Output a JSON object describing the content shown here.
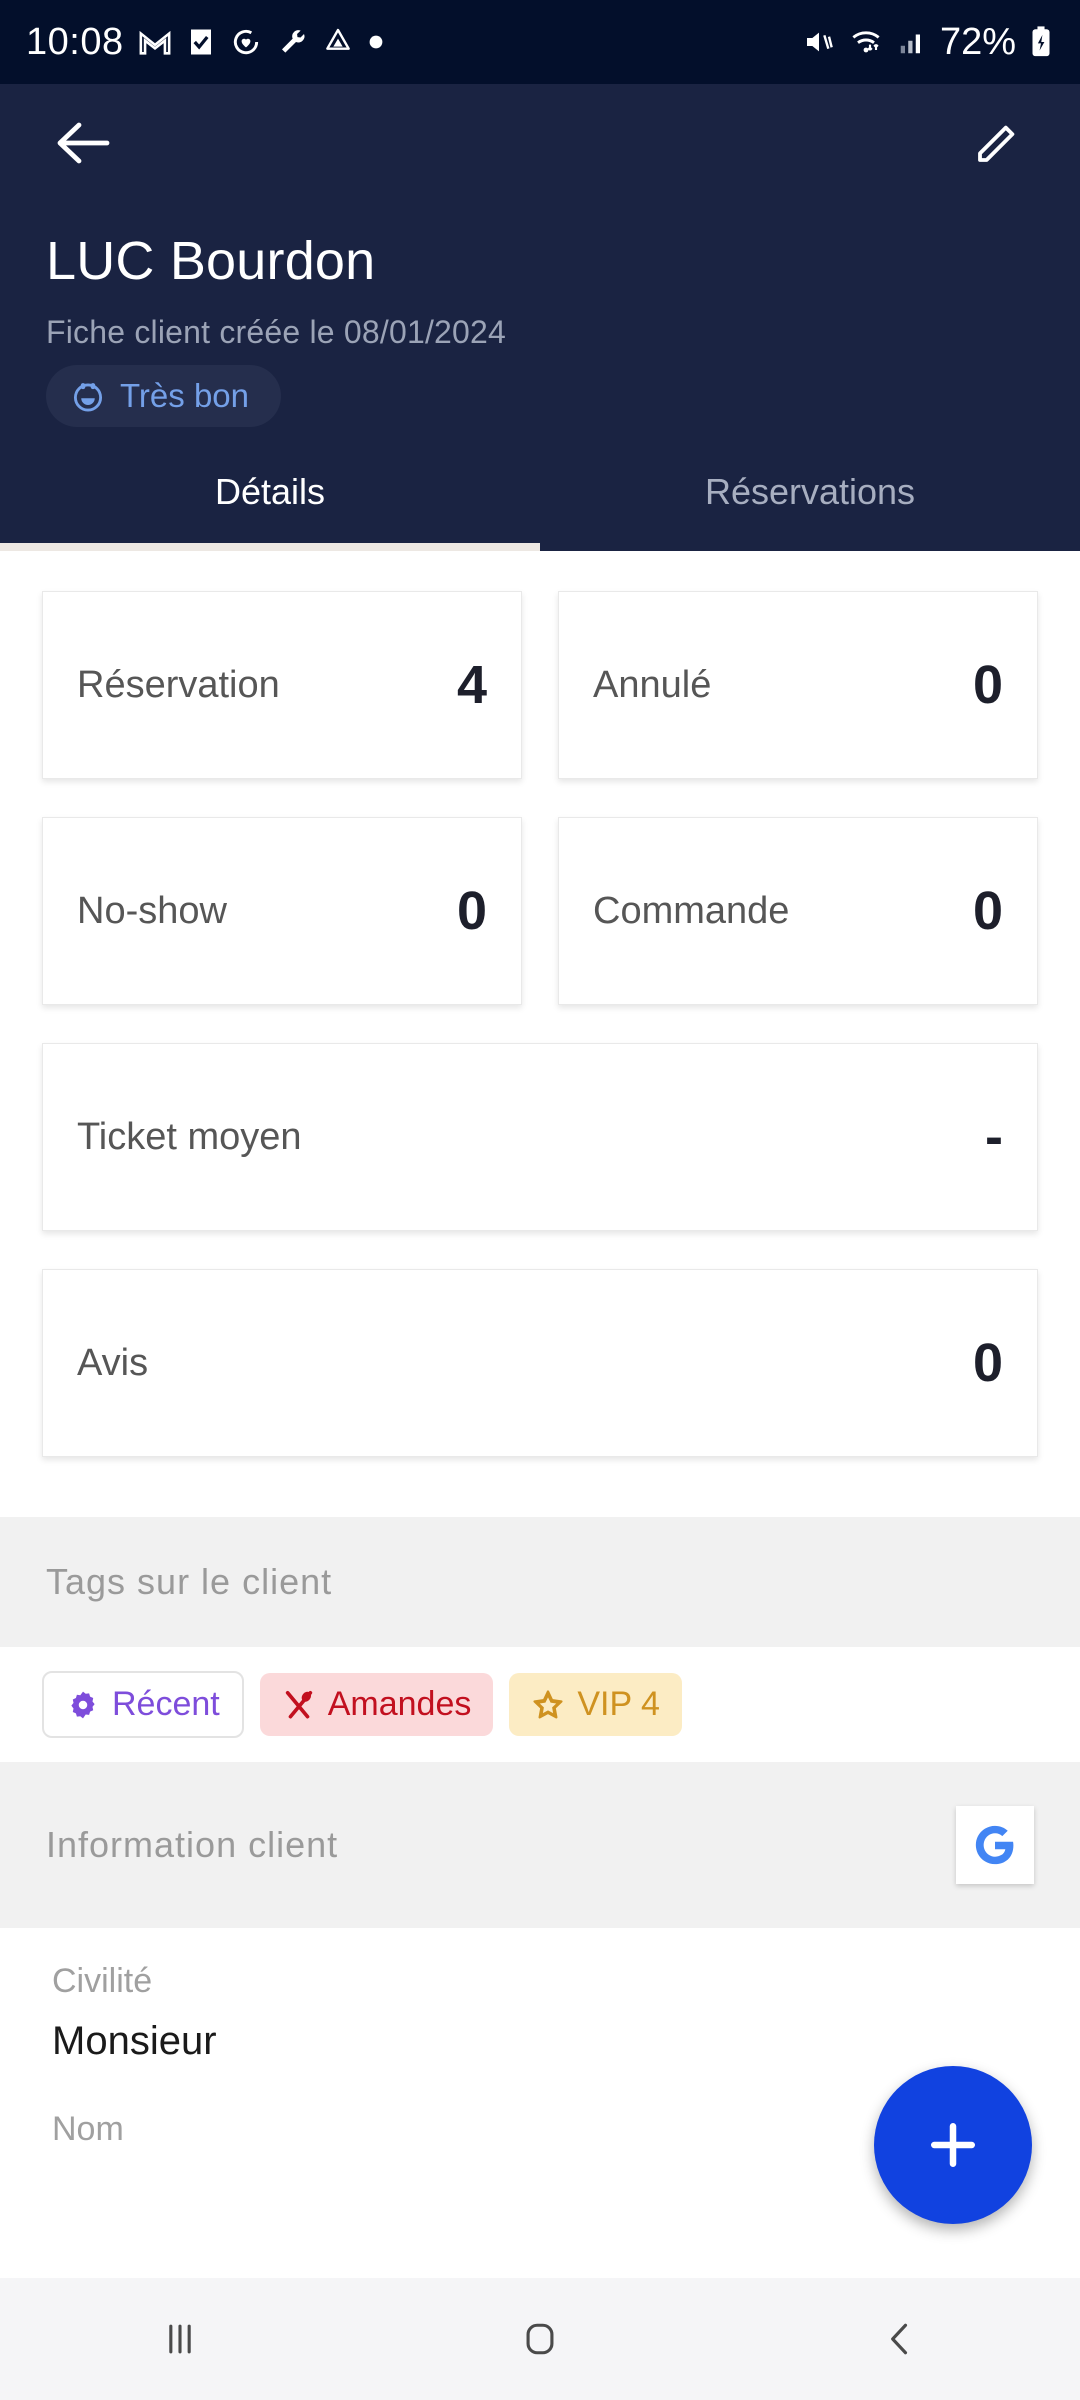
{
  "status_bar": {
    "time": "10:08",
    "battery_percent": "72%",
    "left_icons": [
      "gmail-icon",
      "checkbox-icon",
      "heart-sync-icon",
      "wrench-icon",
      "triangle-icon",
      "dot-icon"
    ],
    "right_icons": [
      "mute-icon",
      "wifi-icon",
      "signal-icon",
      "battery-charging-icon"
    ],
    "background": "#030f2b"
  },
  "app_bar": {
    "back_icon": "arrow-left-icon",
    "edit_icon": "pencil-icon",
    "client_name": "LUC Bourdon",
    "created_text": "Fiche client créée le 08/01/2024",
    "badge": {
      "icon": "smiley-icon",
      "label": "Très bon",
      "color": "#74a0e8"
    },
    "background": "#1a2342"
  },
  "tabs": [
    {
      "label": "Détails",
      "active": true
    },
    {
      "label": "Réservations",
      "active": false
    }
  ],
  "stats": {
    "pairs": [
      [
        {
          "label": "Réservation",
          "value": "4"
        },
        {
          "label": "Annulé",
          "value": "0"
        }
      ],
      [
        {
          "label": "No-show",
          "value": "0"
        },
        {
          "label": "Commande",
          "value": "0"
        }
      ]
    ],
    "wide": [
      {
        "label": "Ticket moyen",
        "value": "-"
      },
      {
        "label": "Avis",
        "value": "0"
      }
    ]
  },
  "tags_section": {
    "title": "Tags sur le client",
    "tags": [
      {
        "label": "Récent",
        "icon": "gear-icon",
        "color": "#7e4ddb",
        "background": "#ffffff"
      },
      {
        "label": "Amandes",
        "icon": "cutlery-icon",
        "color": "#c2101f",
        "background": "#fbd9da"
      },
      {
        "label": "VIP 4",
        "icon": "star-icon",
        "color": "#cf9220",
        "background": "#fcecc4"
      }
    ]
  },
  "info_section": {
    "title": "Information client",
    "google_icon": "google-g-icon",
    "fields": [
      {
        "label": "Civilité",
        "value": "Monsieur"
      },
      {
        "label": "Nom",
        "value": ""
      }
    ]
  },
  "fab": {
    "icon": "plus-icon",
    "color": "#1142e0"
  },
  "nav_bar": {
    "buttons": [
      {
        "icon": "recents-icon"
      },
      {
        "icon": "home-icon"
      },
      {
        "icon": "back-icon"
      }
    ]
  }
}
